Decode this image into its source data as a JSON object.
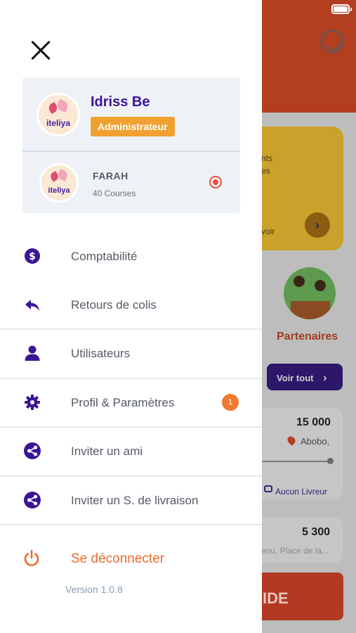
{
  "background": {
    "card_text_1": "nts",
    "card_text_2": "es",
    "card_text_3": "voir",
    "card_arrow": "›",
    "partners_label": "Partenaires",
    "see_all_label": "Voir tout",
    "see_all_chevron": "›",
    "order_1": {
      "amount": "15 000",
      "place": "Abobo,",
      "courier": "Aucun Livreur"
    },
    "order_2": {
      "amount": "5 300",
      "address": "eou, Place de la..."
    },
    "action_button_label": "IDE"
  },
  "drawer": {
    "current_account": {
      "name": "Idriss Be",
      "role": "Administrateur",
      "logo_text": "iteliya"
    },
    "other_account": {
      "name": "FARAH",
      "courses": "40 Courses",
      "logo_text": "iteliya"
    },
    "menu": [
      {
        "label": "Comptabilité",
        "icon": "dollar-icon"
      },
      {
        "label": "Retours de colis",
        "icon": "reply-icon"
      },
      {
        "label": "Utilisateurs",
        "icon": "user-icon"
      },
      {
        "label": "Profil & Paramètres",
        "icon": "gear-icon",
        "badge": "1"
      },
      {
        "label": "Inviter un ami",
        "icon": "share-icon"
      },
      {
        "label": "Inviter un S. de livraison",
        "icon": "share-icon"
      }
    ],
    "logout_label": "Se déconnecter",
    "version": "Version 1.0.8"
  },
  "colors": {
    "brand_purple": "#3b1596",
    "accent_orange": "#ef6a2a",
    "badge_orange": "#f0a030"
  }
}
